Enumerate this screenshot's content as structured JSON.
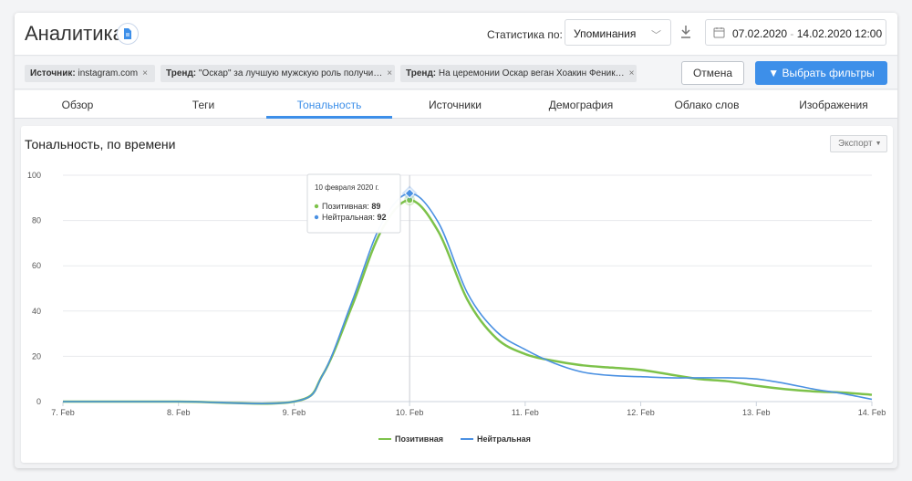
{
  "header": {
    "title": "Аналитика",
    "stat_label": "Статистика по:",
    "stat_value": "Упоминания",
    "date_from": "07.02.2020",
    "date_to": "14.02.2020 12:00"
  },
  "filters": {
    "chips": [
      {
        "key": "Источник:",
        "value": "instagram.com"
      },
      {
        "key": "Тренд:",
        "value": "\"Оскар\" за лучшую мужскую роль получи…"
      },
      {
        "key": "Тренд:",
        "value": "На церемонии Оскар веган Хоакин Феник…"
      }
    ],
    "cancel_label": "Отмена",
    "apply_label": "Выбрать фильтры"
  },
  "tabs": [
    {
      "label": "Обзор",
      "active": false
    },
    {
      "label": "Теги",
      "active": false
    },
    {
      "label": "Тональность",
      "active": true
    },
    {
      "label": "Источники",
      "active": false
    },
    {
      "label": "Демография",
      "active": false
    },
    {
      "label": "Облако слов",
      "active": false
    },
    {
      "label": "Изображения",
      "active": false
    }
  ],
  "card": {
    "title": "Тональность, по времени",
    "export_label": "Экспорт"
  },
  "colors": {
    "accent": "#3d8fe9",
    "positive": "#7dc24a",
    "neutral": "#4a90e2"
  },
  "chart_data": {
    "type": "line",
    "x": [
      "7. Feb",
      "8. Feb",
      "9. Feb",
      "10. Feb",
      "11. Feb",
      "12. Feb",
      "13. Feb",
      "14. Feb"
    ],
    "ylim": [
      0,
      100
    ],
    "yticks": [
      0,
      20,
      40,
      60,
      80,
      100
    ],
    "grid": true,
    "legend_position": "bottom-center",
    "series": [
      {
        "name": "Позитивная",
        "color": "#7dc24a",
        "points": [
          [
            0,
            0
          ],
          [
            1,
            0
          ],
          [
            2,
            0
          ],
          [
            2.25,
            12
          ],
          [
            2.5,
            42
          ],
          [
            2.75,
            75
          ],
          [
            3,
            89
          ],
          [
            3.25,
            75
          ],
          [
            3.5,
            45
          ],
          [
            3.75,
            28
          ],
          [
            4,
            21
          ],
          [
            4.25,
            18
          ],
          [
            4.5,
            16
          ],
          [
            4.75,
            15
          ],
          [
            5,
            14
          ],
          [
            5.25,
            12
          ],
          [
            5.5,
            10
          ],
          [
            5.75,
            9
          ],
          [
            6,
            7
          ],
          [
            6.25,
            5.5
          ],
          [
            6.5,
            4.5
          ],
          [
            6.75,
            4
          ],
          [
            7,
            3
          ]
        ]
      },
      {
        "name": "Нейтральная",
        "color": "#4a90e2",
        "points": [
          [
            0,
            0
          ],
          [
            1,
            0
          ],
          [
            2,
            0
          ],
          [
            2.25,
            12
          ],
          [
            2.5,
            44
          ],
          [
            2.75,
            78
          ],
          [
            3,
            92
          ],
          [
            3.25,
            79
          ],
          [
            3.5,
            48
          ],
          [
            3.75,
            31
          ],
          [
            4,
            23
          ],
          [
            4.25,
            17
          ],
          [
            4.5,
            13
          ],
          [
            4.75,
            11.5
          ],
          [
            5,
            11
          ],
          [
            5.25,
            10.5
          ],
          [
            5.5,
            10.5
          ],
          [
            5.75,
            10.5
          ],
          [
            6,
            10
          ],
          [
            6.25,
            8
          ],
          [
            6.5,
            5.5
          ],
          [
            6.75,
            3.5
          ],
          [
            7,
            1
          ]
        ]
      }
    ],
    "tooltip": {
      "date": "10 февраля 2020 г.",
      "items": [
        {
          "label": "Позитивная:",
          "value": "89",
          "color": "#7dc24a"
        },
        {
          "label": "Нейтральная:",
          "value": "92",
          "color": "#4a90e2"
        }
      ]
    }
  }
}
